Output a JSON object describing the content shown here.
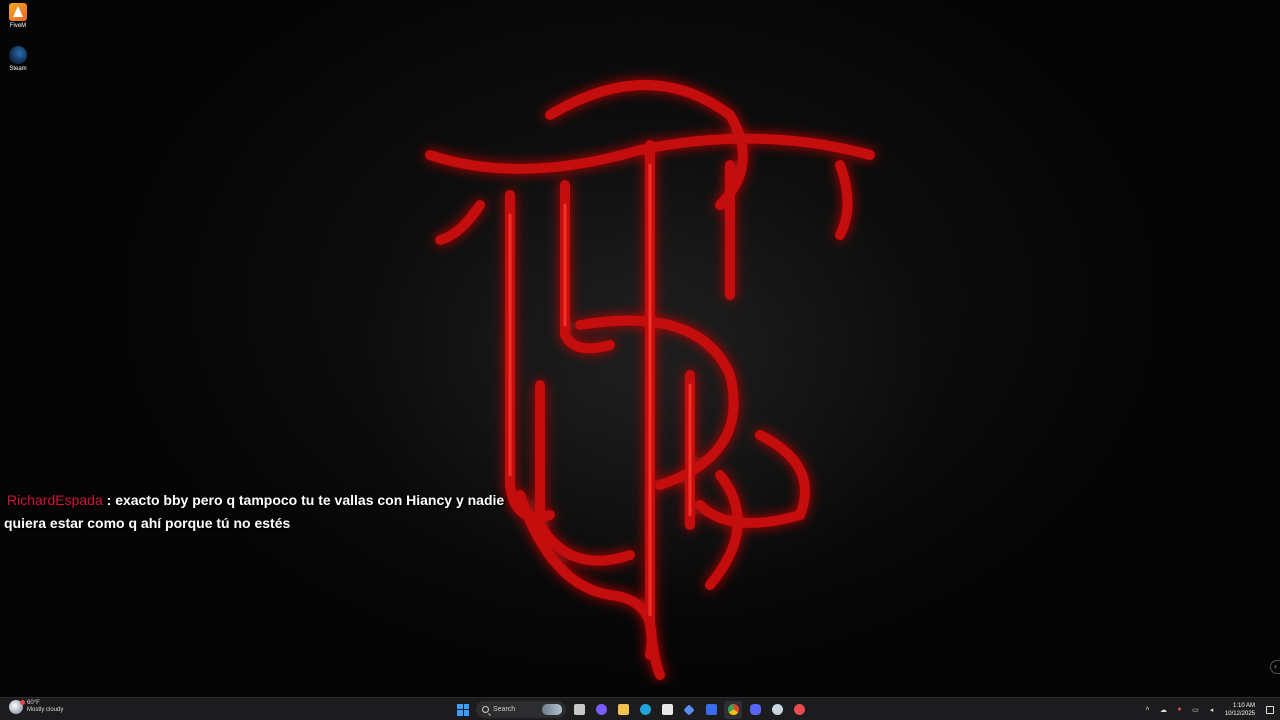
{
  "desktop": {
    "icons": [
      {
        "label": "FiveM"
      },
      {
        "label": "Steam"
      }
    ],
    "wallpaper": {
      "accent_color": "#d10a0a",
      "description_icon": "gothic-monogram-logo"
    }
  },
  "chat": {
    "username": "RichardEspada",
    "separator": ":",
    "message_line1": "exacto bby pero q tampoco tu te vallas con Hiancy y nadie",
    "message_line2": "quiera estar como q ahí porque tú no estés",
    "username_color": "#d3133c"
  },
  "taskbar": {
    "weather": {
      "temp": "60°F",
      "condition": "Mostly cloudy"
    },
    "search_placeholder": "Search",
    "apps": [
      {
        "icon": "task-view-icon",
        "color": "#c8c8c8"
      },
      {
        "icon": "copilot-icon",
        "color": "#7a5cff"
      },
      {
        "icon": "file-explorer-icon",
        "color": "#f2c14e"
      },
      {
        "icon": "edge-icon",
        "color": "#1fa3d8"
      },
      {
        "icon": "store-icon",
        "color": "#e8e8e8"
      },
      {
        "icon": "vpn-icon",
        "color": "#5a8dee"
      },
      {
        "icon": "blue-app-icon",
        "color": "#3b6cf0"
      },
      {
        "icon": "chrome-icon",
        "color": "#e3b341"
      },
      {
        "icon": "discord-icon",
        "color": "#5865f2"
      },
      {
        "icon": "steam-icon",
        "color": "#c7d5e0"
      },
      {
        "icon": "fivem-icon",
        "color": "#e84b4b"
      }
    ],
    "clock": {
      "time": "1:10 AM",
      "date": "10/12/2025"
    }
  }
}
